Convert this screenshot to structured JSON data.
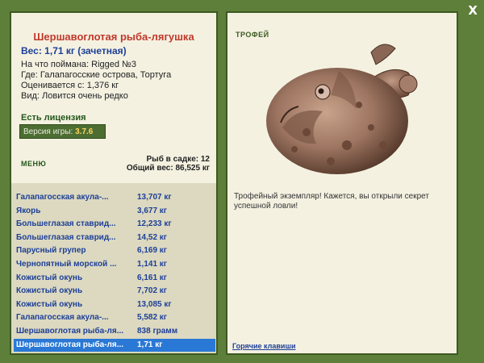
{
  "window": {
    "close_label": "X"
  },
  "fish": {
    "name": "Шершавоглотая рыба-лягушка",
    "weight_line": "Вес: 1,71 кг (зачетная)",
    "bait_line": "На что поймана: Rigged №3",
    "location_line": "Где: Галапагосские острова, Тортуга",
    "value_line": "Оценивается с: 1,376 кг",
    "rarity_line": "Вид: Ловится очень редко"
  },
  "license_text": "Есть лицензия",
  "version": {
    "label": "Версия игры:",
    "value": "3.7.6"
  },
  "menu_label": "МЕНЮ",
  "totals": {
    "count_line": "Рыб в садке: 12",
    "weight_line": "Общий вес: 86,525 кг"
  },
  "catch_list": [
    {
      "name": "Галапагосская акула-...",
      "weight": "13,707 кг"
    },
    {
      "name": "Якорь",
      "weight": "3,677 кг"
    },
    {
      "name": "Большеглазая ставрид...",
      "weight": "12,233 кг"
    },
    {
      "name": "Большеглазая ставрид...",
      "weight": "14,52 кг"
    },
    {
      "name": "Парусный групер",
      "weight": "6,169 кг"
    },
    {
      "name": "Чернопятный морской ...",
      "weight": "1,141 кг"
    },
    {
      "name": "Кожистый окунь",
      "weight": "6,161 кг"
    },
    {
      "name": "Кожистый окунь",
      "weight": "7,702 кг"
    },
    {
      "name": "Кожистый окунь",
      "weight": "13,085 кг"
    },
    {
      "name": "Галапагосская акула-...",
      "weight": "5,582 кг"
    },
    {
      "name": "Шершавоглотая рыба-ля...",
      "weight": "838 грамм"
    },
    {
      "name": "Шершавоглотая рыба-ля...",
      "weight": "1,71 кг",
      "selected": true
    }
  ],
  "trophy_label": "ТРОФЕЙ",
  "trophy_text": "Трофейный экземпляр! Кажется, вы открыли секрет успешной ловли!",
  "hotkeys_label": "Горячие клавиши",
  "colors": {
    "background": "#5e7f3a",
    "panel": "#f4f1e1",
    "title": "#c0392b",
    "link": "#1d3f97",
    "selection": "#2a78d6"
  },
  "icons": {
    "close": "close-icon",
    "fish": "anglerfish-image"
  }
}
